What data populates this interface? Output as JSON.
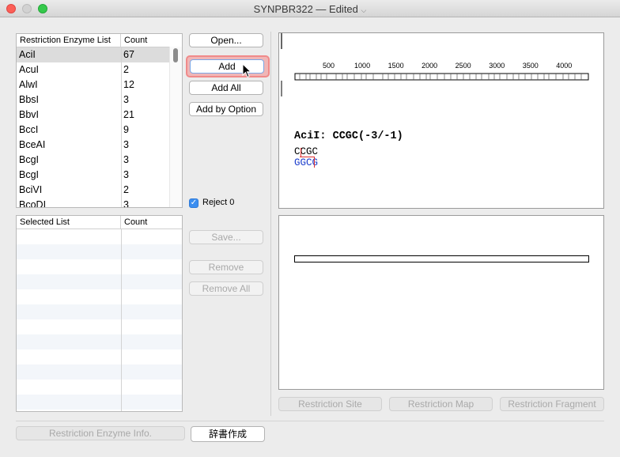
{
  "window": {
    "title": "SYNPBR322 — Edited"
  },
  "enzyme_table": {
    "header_name": "Restriction Enzyme List",
    "header_count": "Count",
    "rows": [
      {
        "name": "AciI",
        "count": "67"
      },
      {
        "name": "AcuI",
        "count": "2"
      },
      {
        "name": "AlwI",
        "count": "12"
      },
      {
        "name": "BbsI",
        "count": "3"
      },
      {
        "name": "BbvI",
        "count": "21"
      },
      {
        "name": "BccI",
        "count": "9"
      },
      {
        "name": "BceAI",
        "count": "3"
      },
      {
        "name": "BcgI",
        "count": "3"
      },
      {
        "name": "BcgI",
        "count": "3"
      },
      {
        "name": "BciVI",
        "count": "2"
      },
      {
        "name": "BcoDI",
        "count": "3"
      }
    ]
  },
  "selected_table": {
    "header_name": "Selected List",
    "header_count": "Count"
  },
  "buttons": {
    "open": "Open...",
    "add": "Add",
    "add_all": "Add All",
    "add_by_option": "Add by Option",
    "save": "Save...",
    "remove": "Remove",
    "remove_all": "Remove All",
    "restriction_enzyme_info": "Restriction Enzyme Info.",
    "dictionary": "辞書作成",
    "restriction_site": "Restriction Site",
    "restriction_map": "Restriction Map",
    "restriction_fragment": "Restriction Fragment"
  },
  "reject_checkbox": {
    "label": "Reject 0",
    "checked": true
  },
  "sequence_map": {
    "ticks": [
      "500",
      "1000",
      "1500",
      "2000",
      "2500",
      "3000",
      "3500",
      "4000"
    ],
    "tick_values": [
      500,
      1000,
      1500,
      2000,
      2500,
      3000,
      3500,
      4000
    ],
    "sequence_length": 4361,
    "site_text": "AciI: CCGC(-3/-1)",
    "top_strand": "CCGC",
    "bottom_strand": "GGCG",
    "bottom_color": "#1a3ccc",
    "cut_color": "#e03030"
  }
}
